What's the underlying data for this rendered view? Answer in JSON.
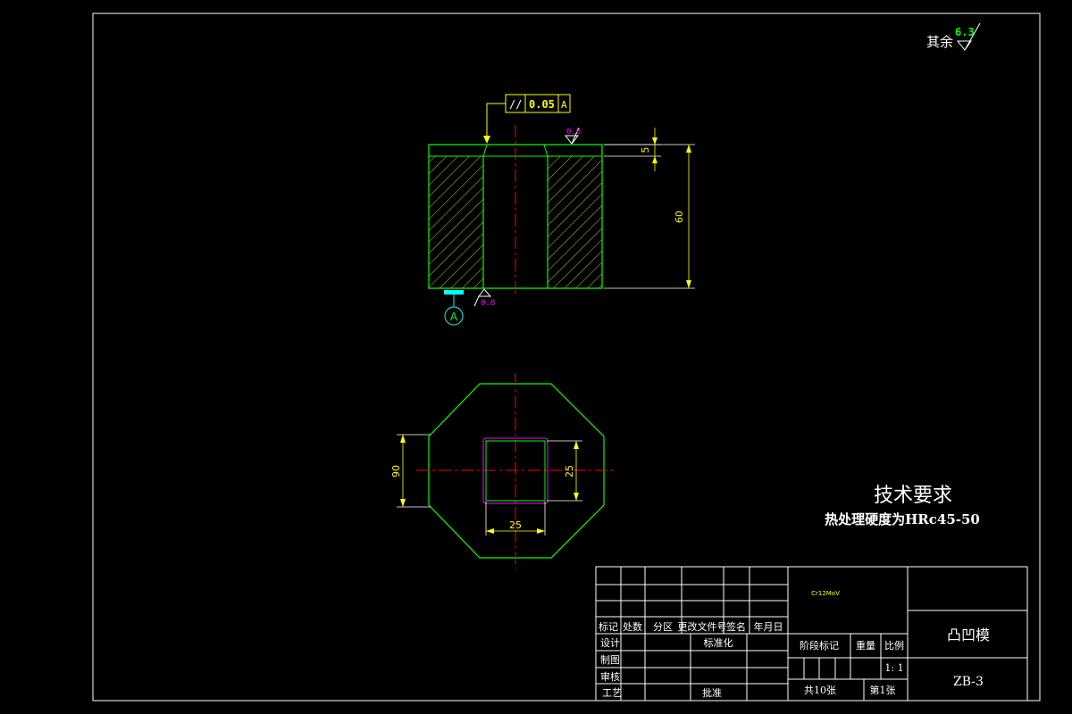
{
  "roughness_general": {
    "prefix": "其余",
    "value": "6.3"
  },
  "front_view": {
    "parallelism_symbol": "//",
    "parallelism_tolerance": "0.05",
    "parallelism_datum": "A",
    "roughness_top": "0.8",
    "roughness_bottom": "0.8",
    "dim_step": "5",
    "dim_height": "60",
    "datum_label": "A"
  },
  "top_view": {
    "dim_overall": "90",
    "dim_hole_width": "25",
    "dim_hole_height": "25"
  },
  "tech_requirements": {
    "title": "技术要求",
    "line1": "热处理硬度为HRc45-50"
  },
  "title_block": {
    "material": "Cr12MoV",
    "part_name": "凸凹模",
    "drawing_no": "ZB-3",
    "col_headers": [
      "标记",
      "处数",
      "分区",
      "更改文件号",
      "签名",
      "年月日"
    ],
    "design": "设计",
    "standardization": "标准化",
    "drawing": "制图",
    "review": "审核",
    "process": "工艺",
    "approve": "批准",
    "stage_mark": "阶段标记",
    "weight": "重量",
    "scale_label": "比例",
    "scale_value": "1: 1",
    "total_sheets": "共10张",
    "sheet_no": "第1张"
  }
}
